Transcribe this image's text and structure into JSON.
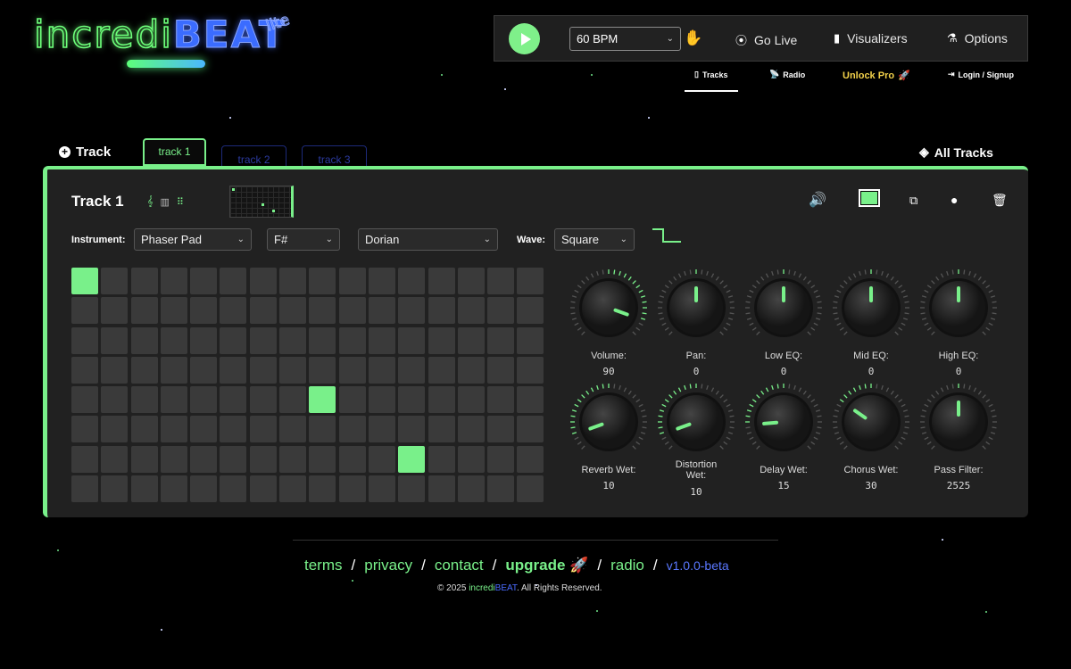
{
  "app": {
    "logo_text_a": "incredi",
    "logo_text_b": "BEAT",
    "logo_lite": "lite"
  },
  "topbar": {
    "play_icon": "play-icon",
    "bpm_value": "60 BPM",
    "tap_icon": "hand-tap-icon",
    "go_live": "Go Live",
    "visualizers": "Visualizers",
    "options": "Options"
  },
  "subnav": {
    "tracks": "Tracks",
    "radio": "Radio",
    "unlock": "Unlock Pro",
    "login": "Login / Signup"
  },
  "tabs": {
    "add_track": "Track",
    "items": [
      {
        "label": "track 1",
        "active": true
      },
      {
        "label": "track 2",
        "active": false
      },
      {
        "label": "track 3",
        "active": false
      }
    ],
    "all_tracks": "All Tracks"
  },
  "track": {
    "name": "Track 1",
    "instrument_label": "Instrument:",
    "instrument": "Phaser Pad",
    "key": "F#",
    "scale": "Dorian",
    "wave_label": "Wave:",
    "wave": "Square",
    "color": "#79f08a"
  },
  "grid": {
    "rows": 8,
    "cols": 16,
    "active_cells": [
      [
        0,
        0
      ],
      [
        4,
        8
      ],
      [
        6,
        11
      ]
    ]
  },
  "knobs": [
    {
      "label": "Volume:",
      "value": "90"
    },
    {
      "label": "Pan:",
      "value": "0"
    },
    {
      "label": "Low EQ:",
      "value": "0"
    },
    {
      "label": "Mid EQ:",
      "value": "0"
    },
    {
      "label": "High EQ:",
      "value": "0"
    },
    {
      "label": "Reverb Wet:",
      "value": "10"
    },
    {
      "label": "Distortion Wet:",
      "value": "10"
    },
    {
      "label": "Delay Wet:",
      "value": "15"
    },
    {
      "label": "Chorus Wet:",
      "value": "30"
    },
    {
      "label": "Pass Filter:",
      "value": "2525"
    }
  ],
  "footer": {
    "terms": "terms",
    "privacy": "privacy",
    "contact": "contact",
    "upgrade": "upgrade",
    "radio": "radio",
    "version": "v1.0.0-beta",
    "copyright_pre": "© 2025",
    "copyright_a": "incredi",
    "copyright_b": "BEAT",
    "copyright_post": ". All Rights Reserved."
  },
  "colors": {
    "accent": "#79f08a",
    "brand_blue": "#3b6cff",
    "background": "#000000",
    "panel": "#212121"
  }
}
